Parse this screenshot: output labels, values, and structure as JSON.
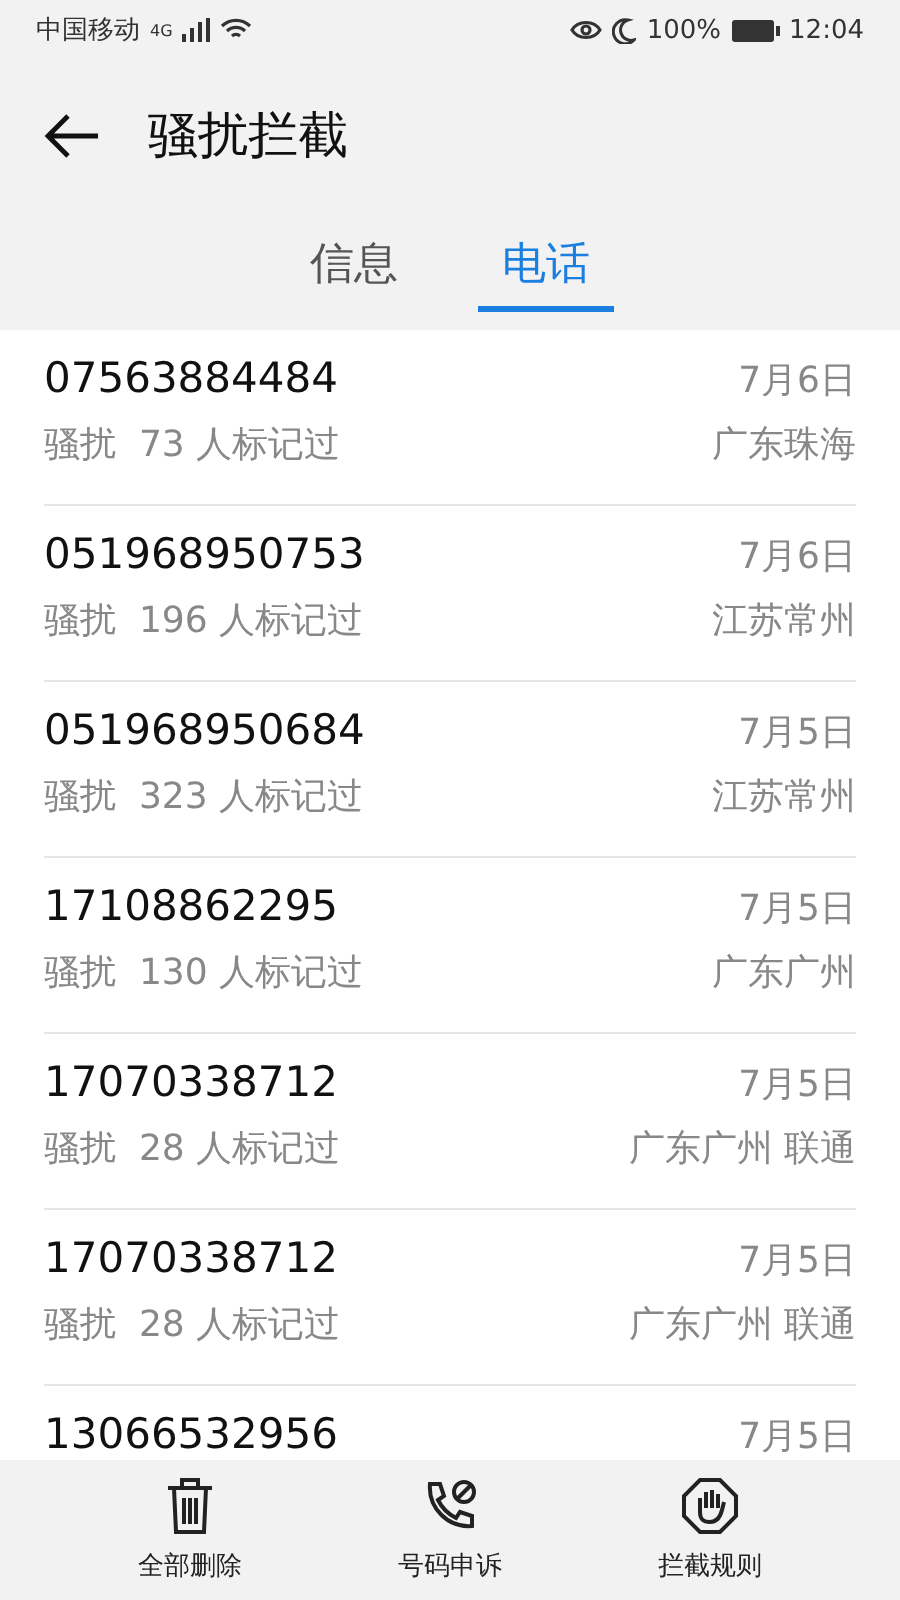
{
  "status_bar": {
    "carrier": "中国移动",
    "network": "4G",
    "battery": "100%",
    "time": "12:04"
  },
  "header": {
    "title": "骚扰拦截"
  },
  "tabs": [
    {
      "label": "信息",
      "selected": false
    },
    {
      "label": "电话",
      "selected": true
    }
  ],
  "calls": [
    {
      "number": "07563884484",
      "date": "7月6日",
      "tag": "骚扰",
      "reports": "73 人标记过",
      "location": "广东珠海"
    },
    {
      "number": "051968950753",
      "date": "7月6日",
      "tag": "骚扰",
      "reports": "196 人标记过",
      "location": "江苏常州"
    },
    {
      "number": "051968950684",
      "date": "7月5日",
      "tag": "骚扰",
      "reports": "323 人标记过",
      "location": "江苏常州"
    },
    {
      "number": "17108862295",
      "date": "7月5日",
      "tag": "骚扰",
      "reports": "130 人标记过",
      "location": "广东广州"
    },
    {
      "number": "17070338712",
      "date": "7月5日",
      "tag": "骚扰",
      "reports": "28 人标记过",
      "location": "广东广州 联通"
    },
    {
      "number": "17070338712",
      "date": "7月5日",
      "tag": "骚扰",
      "reports": "28 人标记过",
      "location": "广东广州 联通"
    },
    {
      "number": "13066532956",
      "date": "7月5日"
    }
  ],
  "actions": [
    {
      "kind": "delete",
      "label": "全部删除"
    },
    {
      "kind": "appeal",
      "label": "号码申诉"
    },
    {
      "kind": "rules",
      "label": "拦截规则"
    }
  ]
}
